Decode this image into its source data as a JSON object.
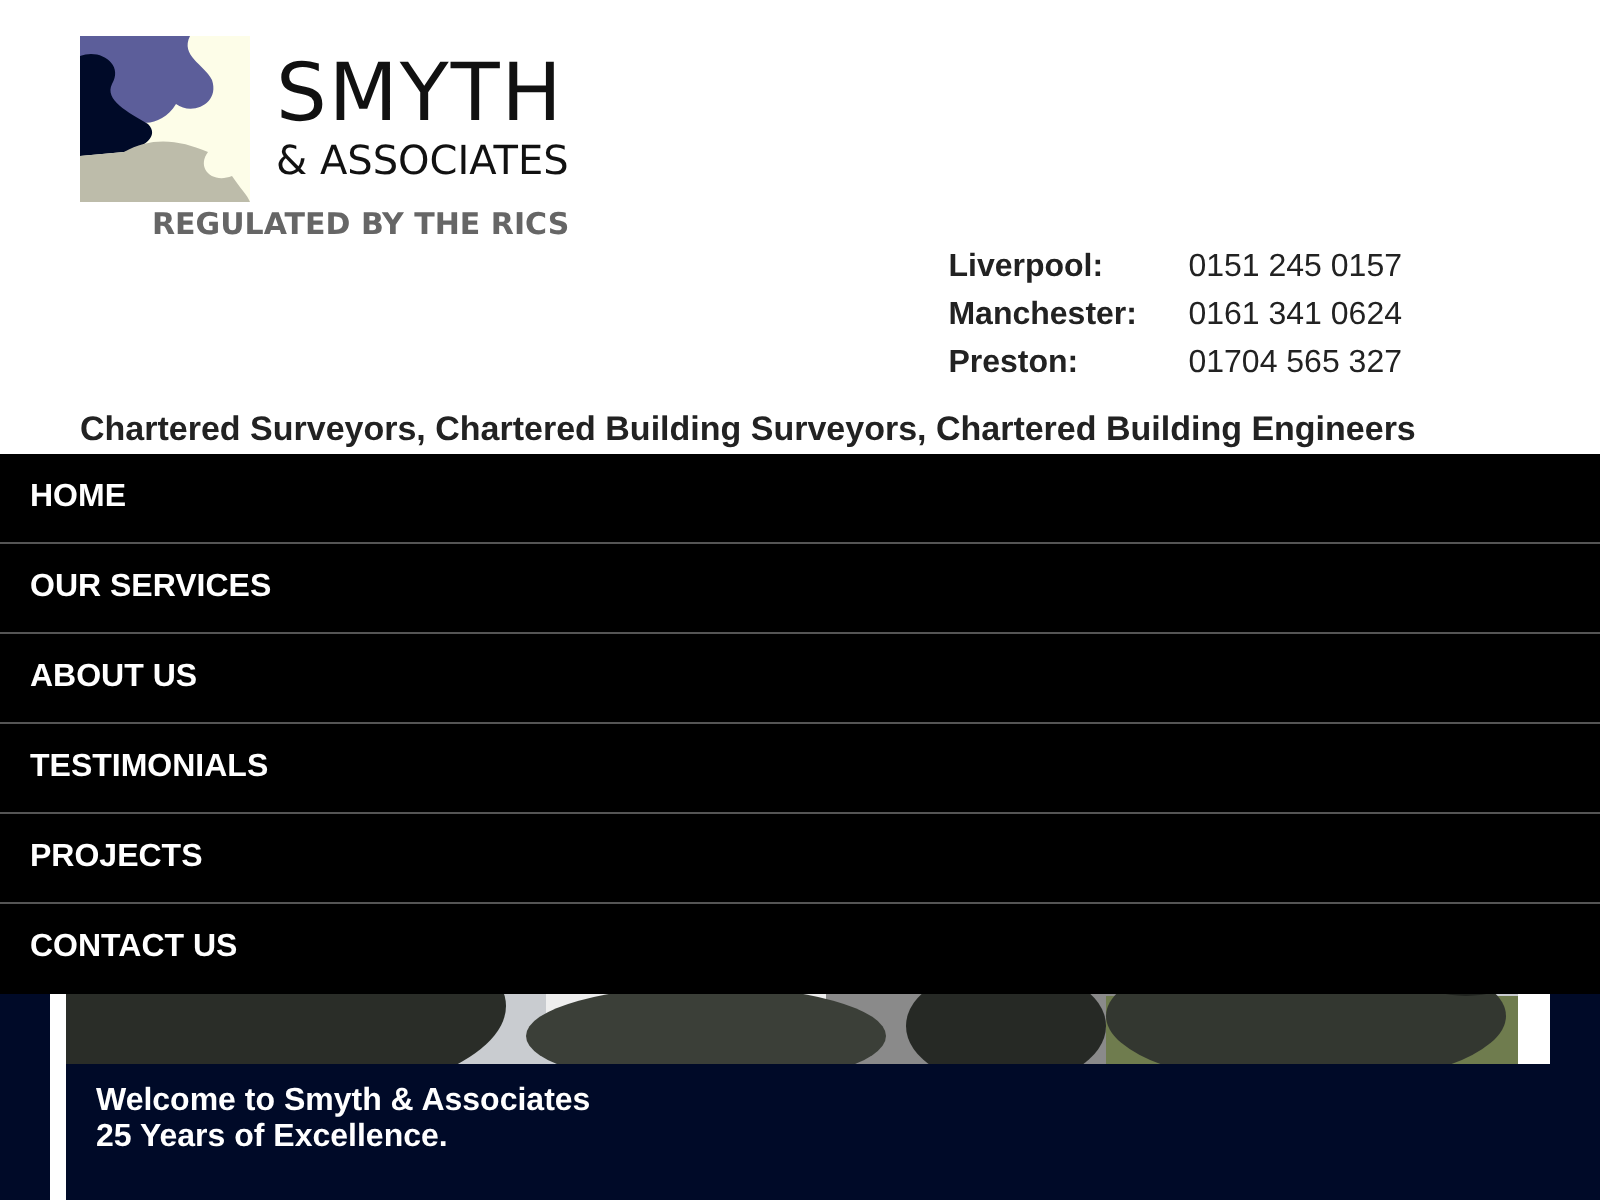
{
  "logo": {
    "name": "SMYTH",
    "subtitle": "& ASSOCIATES",
    "tagline": "REGULATED BY THE RICS"
  },
  "offices": [
    {
      "city": "Liverpool:",
      "phone": "0151 245 0157"
    },
    {
      "city": "Manchester:",
      "phone": "0161 341 0624"
    },
    {
      "city": "Preston:",
      "phone": "01704 565 327"
    }
  ],
  "services_line": "Chartered Surveyors, Chartered Building Surveyors, Chartered Building Engineers",
  "menu": [
    {
      "label": "HOME"
    },
    {
      "label": "OUR SERVICES"
    },
    {
      "label": "ABOUT US"
    },
    {
      "label": "TESTIMONIALS"
    },
    {
      "label": "PROJECTS"
    },
    {
      "label": "CONTACT US"
    }
  ],
  "welcome": {
    "title": "Welcome to Smyth & Associates",
    "subtitle": "25 Years of Excellence."
  }
}
